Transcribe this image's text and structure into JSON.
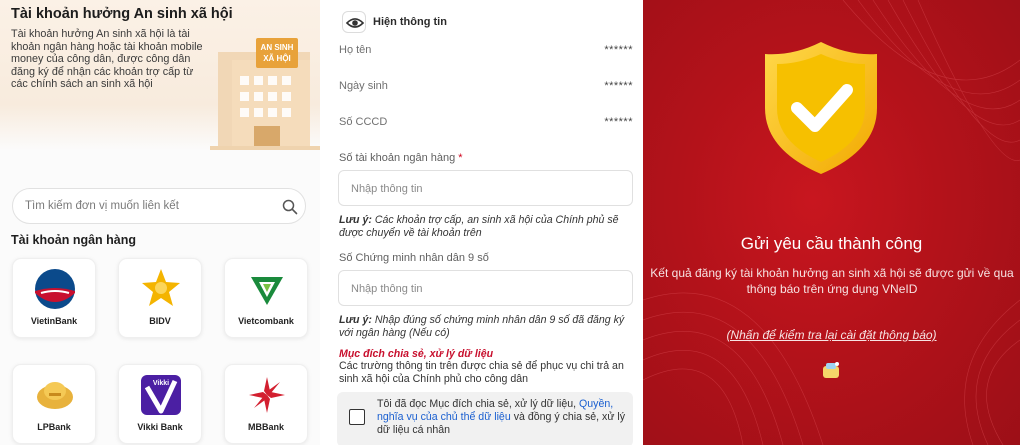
{
  "panel1": {
    "title": "Tài khoản hưởng An sinh xã hội",
    "description": "Tài khoản hưởng An sinh xã hội là tài khoản ngân hàng hoặc tài khoản mobile money của công dân, được công dân đăng ký để nhận các khoản trợ cấp từ các chính sách an sinh xã hội",
    "building_sign_line1": "AN SINH",
    "building_sign_line2": "XÃ HỘI",
    "search_placeholder": "Tìm kiếm đơn vị muốn liên kết",
    "section_title": "Tài khoản ngân hàng",
    "banks": [
      {
        "name": "VietinBank",
        "icon": "vietinbank-logo"
      },
      {
        "name": "BIDV",
        "icon": "bidv-logo"
      },
      {
        "name": "Vietcombank",
        "icon": "vietcombank-logo"
      },
      {
        "name": "LPBank",
        "icon": "lpbank-logo"
      },
      {
        "name": "Vikki Bank",
        "icon": "vikkibank-logo"
      },
      {
        "name": "MBBank",
        "icon": "mbbank-logo"
      }
    ],
    "vikki_logo_text": "Vikki"
  },
  "panel2": {
    "show_info_label": "Hiện thông tin",
    "rows": [
      {
        "label": "Họ tên",
        "value": "******"
      },
      {
        "label": "Ngày sinh",
        "value": "******"
      },
      {
        "label": "Số CCCD",
        "value": "******"
      }
    ],
    "bank_account_label": "Số tài khoản ngân hàng",
    "required_mark": "*",
    "bank_account_placeholder": "Nhập thông tin",
    "note1_label": "Lưu ý:",
    "note1_text": "Các khoản trợ cấp, an sinh xã hội của Chính phủ sẽ được chuyển về tài khoản trên",
    "id9_label": "Số Chứng minh nhân dân 9 số",
    "id9_placeholder": "Nhập thông tin",
    "note2_label": "Lưu ý:",
    "note2_text": "Nhập đúng số chứng minh nhân dân 9 số đã đăng ký với ngân hàng (Nếu có)",
    "purpose_heading": "Mục đích chia sẻ, xử lý dữ liệu",
    "purpose_text": "Các trường thông tin trên được chia sẻ để phục vụ chi trả an sinh xã hội của Chính phủ cho công dân",
    "consent_before": "Tôi đã đọc Mục đích chia sẻ, xử lý dữ liệu,",
    "consent_link": "Quyền, nghĩa vụ của chủ thể dữ liệu",
    "consent_after": "và đồng ý chia sẻ, xử lý dữ liệu cá nhân"
  },
  "panel3": {
    "title": "Gửi yêu cầu thành công",
    "subtitle": "Kết quả đăng ký tài khoản hưởng an sinh xã hội sẽ được gửi về qua thông báo trên ứng dụng VNeID",
    "link_text": "(Nhấn để kiểm tra lại cài đặt thông báo)"
  },
  "colors": {
    "accent_red": "#c8102e",
    "success_bg": "#b3121a",
    "shield_yellow": "#f6c000",
    "link_blue": "#1a5fd0"
  }
}
